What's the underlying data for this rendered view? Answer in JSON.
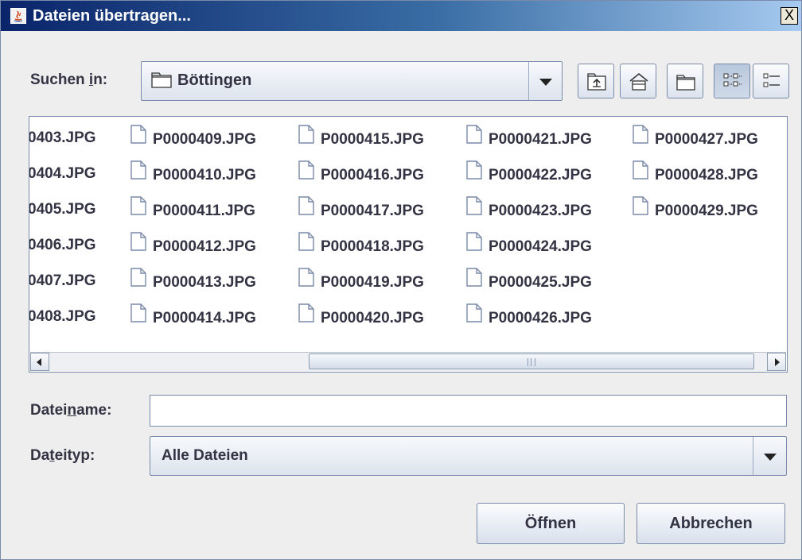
{
  "window": {
    "title": "Dateien übertragen...",
    "close_label": "X"
  },
  "lookin": {
    "label_pre": "Suchen ",
    "label_mnemonic": "i",
    "label_post": "n:",
    "value": "Böttingen",
    "icon": "folder-icon"
  },
  "toolbar": {
    "buttons": [
      {
        "name": "up-one-level",
        "icon": "folder-up-icon"
      },
      {
        "name": "home",
        "icon": "home-icon"
      },
      {
        "name": "new-folder",
        "icon": "new-folder-icon"
      },
      {
        "name": "list-view",
        "icon": "list-view-icon",
        "pressed": true
      },
      {
        "name": "details-view",
        "icon": "details-view-icon",
        "pressed": false
      }
    ]
  },
  "files": {
    "columns": [
      [
        "0403.JPG",
        "0404.JPG",
        "0405.JPG",
        "0406.JPG",
        "0407.JPG",
        "0408.JPG"
      ],
      [
        "P0000409.JPG",
        "P0000410.JPG",
        "P0000411.JPG",
        "P0000412.JPG",
        "P0000413.JPG",
        "P0000414.JPG"
      ],
      [
        "P0000415.JPG",
        "P0000416.JPG",
        "P0000417.JPG",
        "P0000418.JPG",
        "P0000419.JPG",
        "P0000420.JPG"
      ],
      [
        "P0000421.JPG",
        "P0000422.JPG",
        "P0000423.JPG",
        "P0000424.JPG",
        "P0000425.JPG",
        "P0000426.JPG"
      ],
      [
        "P0000427.JPG",
        "P0000428.JPG",
        "P0000429.JPG"
      ]
    ]
  },
  "filename": {
    "label_pre": "Datei",
    "label_mnemonic": "n",
    "label_post": "ame:",
    "value": "",
    "placeholder": ""
  },
  "filetype": {
    "label_pre": "Da",
    "label_mnemonic": "t",
    "label_post": "eityp:",
    "value": "Alle Dateien"
  },
  "buttons": {
    "open_label": "Öffnen",
    "cancel_label": "Abbrechen"
  },
  "colors": {
    "title_gradient_start": "#0a246a",
    "title_gradient_end": "#a6caf0",
    "text": "#333344"
  }
}
